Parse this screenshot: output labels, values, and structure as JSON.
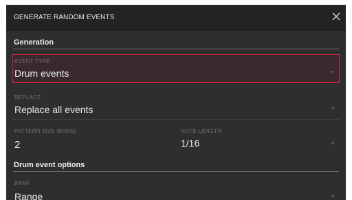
{
  "dialog": {
    "title": "GENERATE RANDOM EVENTS",
    "close_icon": "close-icon"
  },
  "generation": {
    "heading": "Generation",
    "event_type": {
      "label": "EVENT TYPE",
      "value": "Drum events"
    },
    "replace": {
      "label": "REPLACE",
      "value": "Replace all events"
    },
    "pattern_size": {
      "label": "PATTERN SIZE (BARS)",
      "value": "2"
    },
    "note_length": {
      "label": "NOTE LENGTH",
      "value": "1/16"
    }
  },
  "drum_options": {
    "heading": "Drum event options",
    "bank": {
      "label": "BANK",
      "value": "Range"
    }
  },
  "colors": {
    "selected_border": "#c5273f",
    "background": "#2e2e2e",
    "titlebar": "#232323"
  }
}
